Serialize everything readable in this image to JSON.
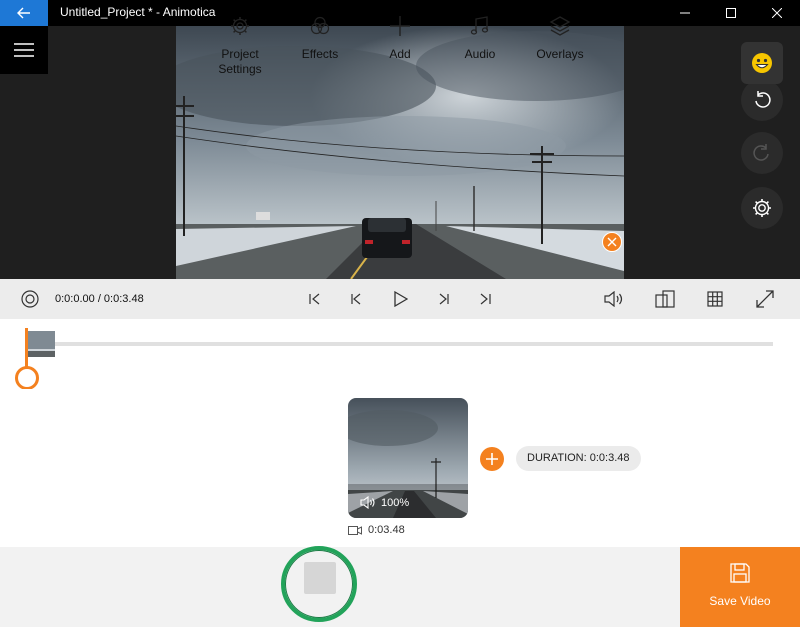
{
  "window": {
    "title": "Untitled_Project * - Animotica"
  },
  "playback": {
    "timecode": "0:0:0.00 / 0:0:3.48"
  },
  "clip": {
    "volume": "100%",
    "duration_chip": "DURATION: 0:0:3.48",
    "length": "0:03.48"
  },
  "toolbar": {
    "project_settings_label": "Project\nSettings",
    "effects_label": "Effects",
    "add_label": "Add",
    "audio_label": "Audio",
    "overlays_label": "Overlays",
    "save_video_label": "Save Video"
  },
  "colors": {
    "accent": "#f4811f",
    "titlebar_back": "#1e78d6",
    "highlight_ring": "#22a35a"
  }
}
